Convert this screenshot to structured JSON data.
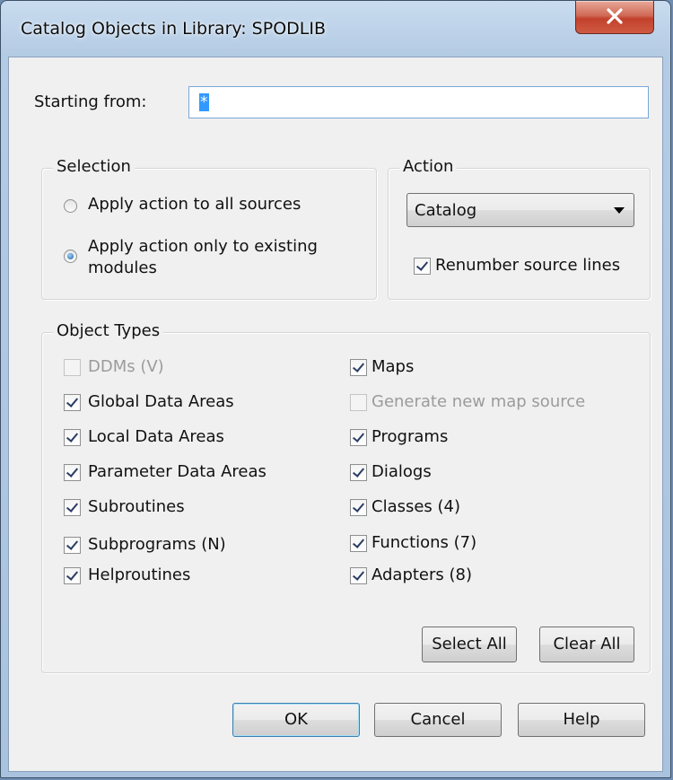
{
  "window": {
    "title": "Catalog Objects in Library: SPODLIB"
  },
  "starting_from": {
    "label": "Starting from:",
    "value": "*"
  },
  "selection": {
    "title": "Selection",
    "options": [
      {
        "label": "Apply action to all sources",
        "checked": false
      },
      {
        "label_line1": "Apply action only to existing",
        "label_line2": "modules",
        "checked": true
      }
    ]
  },
  "action": {
    "title": "Action",
    "selected": "Catalog",
    "renumber": {
      "label": "Renumber source lines",
      "checked": true
    }
  },
  "object_types": {
    "title": "Object Types",
    "left": [
      {
        "label": "DDMs (V)",
        "checked": false,
        "enabled": false
      },
      {
        "label": "Global Data Areas",
        "checked": true,
        "enabled": true
      },
      {
        "label": "Local Data Areas",
        "checked": true,
        "enabled": true
      },
      {
        "label": "Parameter Data Areas",
        "checked": true,
        "enabled": true
      },
      {
        "label": "Subroutines",
        "checked": true,
        "enabled": true
      },
      {
        "label": "Subprograms (N)",
        "checked": true,
        "enabled": true
      },
      {
        "label": "Helproutines",
        "checked": true,
        "enabled": true
      }
    ],
    "right": [
      {
        "label": "Maps",
        "checked": true,
        "enabled": true
      },
      {
        "label": "Generate new map source",
        "checked": false,
        "enabled": false
      },
      {
        "label": "Programs",
        "checked": true,
        "enabled": true
      },
      {
        "label": "Dialogs",
        "checked": true,
        "enabled": true
      },
      {
        "label": "Classes (4)",
        "checked": true,
        "enabled": true
      },
      {
        "label": "Functions (7)",
        "checked": true,
        "enabled": true
      },
      {
        "label": "Adapters (8)",
        "checked": true,
        "enabled": true
      }
    ],
    "select_all": "Select All",
    "clear_all": "Clear All"
  },
  "buttons": {
    "ok": "OK",
    "cancel": "Cancel",
    "help": "Help"
  }
}
